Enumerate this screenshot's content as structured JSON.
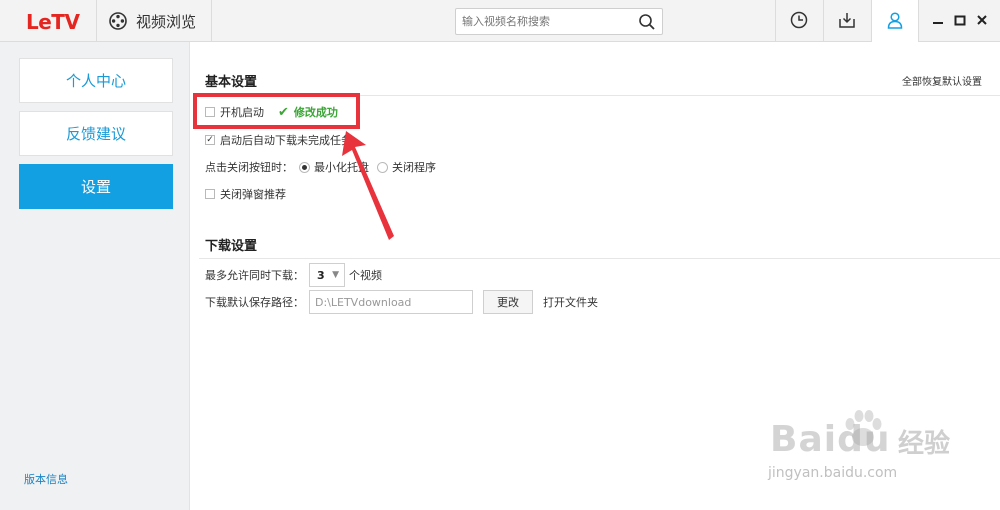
{
  "app": {
    "logo": "LeTV",
    "browse_label": "视频浏览"
  },
  "search": {
    "placeholder": "输入视频名称搜索"
  },
  "sidebar": {
    "items": [
      {
        "label": "个人中心",
        "active": false
      },
      {
        "label": "反馈建议",
        "active": false
      },
      {
        "label": "设置",
        "active": true
      }
    ],
    "version_link": "版本信息"
  },
  "basic": {
    "title": "基本设置",
    "restore_all": "全部恢复默认设置",
    "autostart": {
      "label": "开机启动",
      "checked": false
    },
    "success_msg": "修改成功",
    "auto_download": {
      "label": "启动后自动下载未完成任务",
      "checked": true
    },
    "close_action": {
      "label": "点击关闭按钮时：",
      "options": [
        {
          "label": "最小化托盘",
          "selected": true
        },
        {
          "label": "关闭程序",
          "selected": false
        }
      ]
    },
    "close_popup": {
      "label": "关闭弹窗推荐",
      "checked": false
    }
  },
  "download": {
    "title": "下载设置",
    "max_concurrent_label": "最多允许同时下载：",
    "max_concurrent_value": "3",
    "max_concurrent_unit": "个视频",
    "path_label": "下载默认保存路径：",
    "path_value": "D:\\LETVdownload",
    "change_button": "更改",
    "open_folder": "打开文件夹"
  },
  "watermark": {
    "brand": "Baidu",
    "cn": "经验",
    "url": "jingyan.baidu.com"
  },
  "colors": {
    "accent": "#12a0e2",
    "logo": "#e42520",
    "success": "#3aa635",
    "annotation": "#e8323c"
  }
}
